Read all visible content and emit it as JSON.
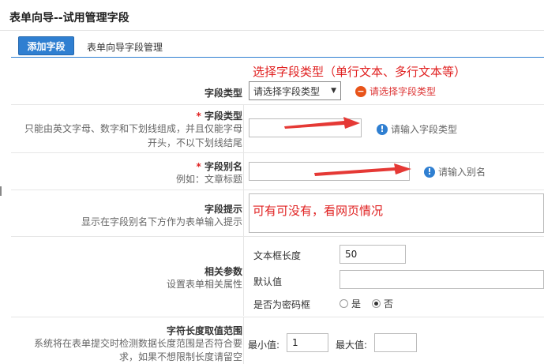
{
  "page": {
    "title": "表单向导--试用管理字段"
  },
  "tabs": {
    "active": "添加字段",
    "other": "表单向导字段管理"
  },
  "annotations": {
    "select_type": "选择字段类型（单行文本、多行文本等）",
    "hint_optional": "可有可没有，看网页情况"
  },
  "rows": {
    "field_type": {
      "label": "字段类型",
      "select_value": "请选择字段类型",
      "error": "请选择字段类型"
    },
    "field_name": {
      "required_mark": "*",
      "label": "字段类型",
      "desc1": "只能由英文字母、数字和下划线组成，并且仅能字母",
      "desc2": "开头，不以下划线结尾",
      "value": "",
      "hint": "请输入字段类型"
    },
    "field_alias": {
      "required_mark": "*",
      "label": "字段别名",
      "desc": "例如：文章标题",
      "value": "",
      "hint": "请输入别名"
    },
    "field_tip": {
      "label": "字段提示",
      "desc": "显示在字段别名下方作为表单输入提示"
    },
    "params": {
      "label": "相关参数",
      "desc": "设置表单相关属性",
      "textbox_len_label": "文本框长度",
      "textbox_len_value": "50",
      "default_label": "默认值",
      "default_value": "",
      "password_label": "是否为密码框",
      "yes": "是",
      "no": "否",
      "password_selected": "否"
    },
    "length_range": {
      "label": "字符长度取值范围",
      "desc1": "系统将在表单提交时检测数据长度范围是否符合要",
      "desc2": "求，如果不想限制长度请留空",
      "min_label": "最小值:",
      "min_value": "1",
      "max_label": "最大值:",
      "max_value": ""
    }
  },
  "colors": {
    "accent": "#2f7fd1",
    "annotation": "#e02020",
    "info_icon": "#2f7fd1",
    "error_icon": "#e8541a"
  }
}
